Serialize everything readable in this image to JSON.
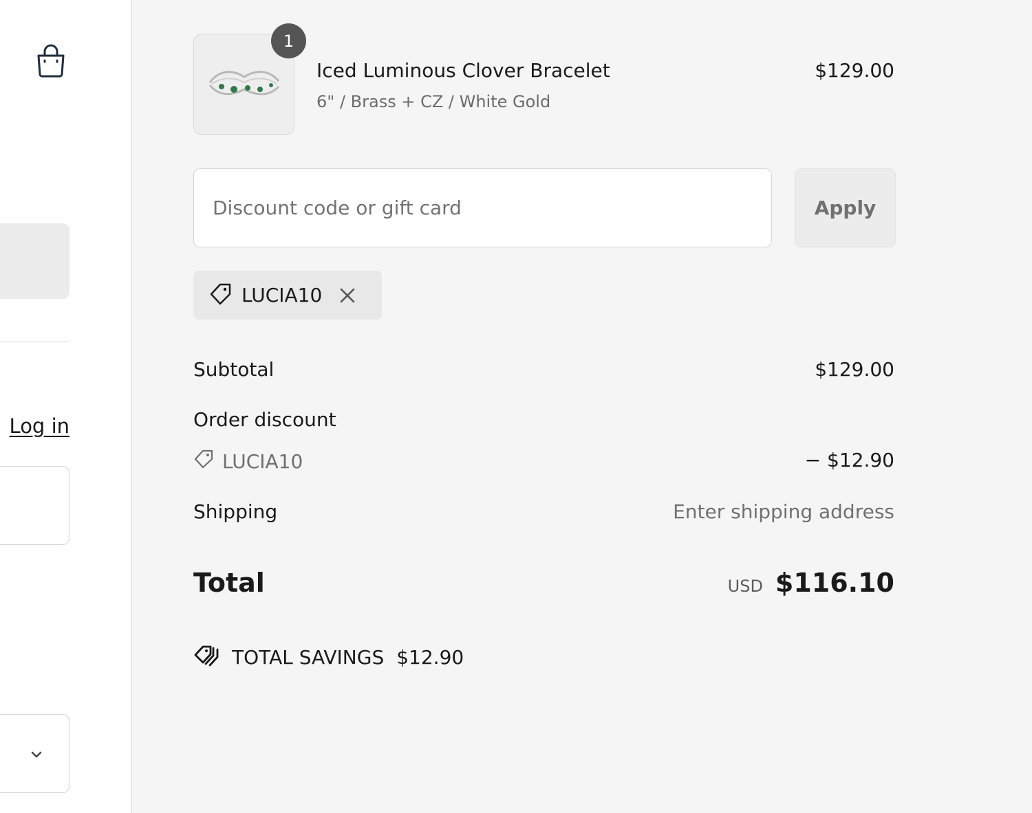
{
  "left_panel": {
    "login_link": "Log in"
  },
  "cart": {
    "items": [
      {
        "quantity": "1",
        "name": "Iced Luminous Clover Bracelet",
        "variant": "6\" / Brass + CZ / White Gold",
        "price": "$129.00"
      }
    ]
  },
  "discount": {
    "placeholder": "Discount code or gift card",
    "apply_label": "Apply",
    "applied_code": "LUCIA10"
  },
  "summary": {
    "subtotal_label": "Subtotal",
    "subtotal_value": "$129.00",
    "order_discount_label": "Order discount",
    "discount_code": "LUCIA10",
    "discount_value": "− $12.90",
    "shipping_label": "Shipping",
    "shipping_value": "Enter shipping address",
    "total_label": "Total",
    "total_currency": "USD",
    "total_value": "$116.10",
    "savings_label": "TOTAL SAVINGS",
    "savings_value": "$12.90"
  },
  "icons": {
    "cart": "shopping-bag-icon",
    "tag": "tag-icon",
    "remove": "close-icon",
    "savings": "tags-icon",
    "select": "chevron-down-icon"
  },
  "colors": {
    "summary_background": "#f5f5f5",
    "badge": "#555555",
    "muted_text": "#707070",
    "apply_button": "#ececec"
  }
}
